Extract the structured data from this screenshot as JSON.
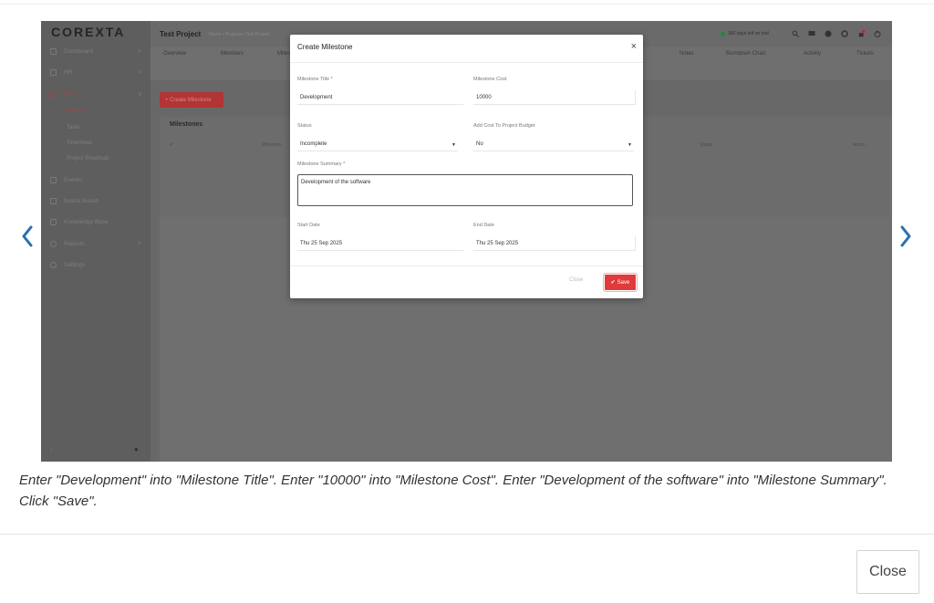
{
  "screenshot": {
    "logo": "COREXTA",
    "sidebar": {
      "items": [
        {
          "label": "Dashboard",
          "chevron": ">"
        },
        {
          "label": "HR",
          "chevron": ">"
        },
        {
          "label": "Work",
          "chevron": "v"
        },
        {
          "label": "Events",
          "chevron": ""
        },
        {
          "label": "Notice Board",
          "chevron": ""
        },
        {
          "label": "Knowledge Base",
          "chevron": ""
        },
        {
          "label": "Reports",
          "chevron": ">"
        },
        {
          "label": "Settings",
          "chevron": ""
        }
      ],
      "sub_items": [
        "Projects",
        "Tasks",
        "Timesheet",
        "Project Roadmap"
      ],
      "bottom_left": "‹",
      "bottom_right": "●"
    },
    "header": {
      "title": "Test Project",
      "breadcrumb": "Home • Projects • Test Project",
      "trial": "360 days left on trial",
      "trial_color": "#1f8a3a"
    },
    "tabs": [
      "Overview",
      "Members",
      "Milestones",
      "Notes",
      "Burndown Chart",
      "Activity",
      "Tickets"
    ],
    "create_button": "+ Create Milestone",
    "milestones": {
      "title": "Milestones",
      "columns": [
        "#",
        "Milestone",
        "Status",
        "Action"
      ]
    }
  },
  "modal": {
    "title": "Create Milestone",
    "close_icon": "×",
    "fields": {
      "milestone_title": {
        "label": "Milestone Title *",
        "value": "Development"
      },
      "milestone_cost": {
        "label": "Milestone Cost",
        "value": "10000"
      },
      "status": {
        "label": "Status",
        "value": "Incomplete"
      },
      "add_cost": {
        "label": "Add Cost To Project Budget",
        "value": "No"
      },
      "summary": {
        "label": "Milestone Summary *",
        "value": "Development of the software"
      },
      "start_date": {
        "label": "Start Date",
        "value": "Thu 25 Sep 2025"
      },
      "end_date": {
        "label": "End Date",
        "value": "Thu 25 Sep 2025"
      }
    },
    "close_label": "Close",
    "save_label": "Save",
    "save_color": "#e03a3a"
  },
  "caption": "Enter \"Development\" into \"Milestone Title\". Enter \"10000\" into \"Milestone Cost\". Enter \"Development of the software\" into \"Milestone Summary\". Click \"Save\".",
  "close_button": "Close",
  "nav_color": "#2a6fb0"
}
